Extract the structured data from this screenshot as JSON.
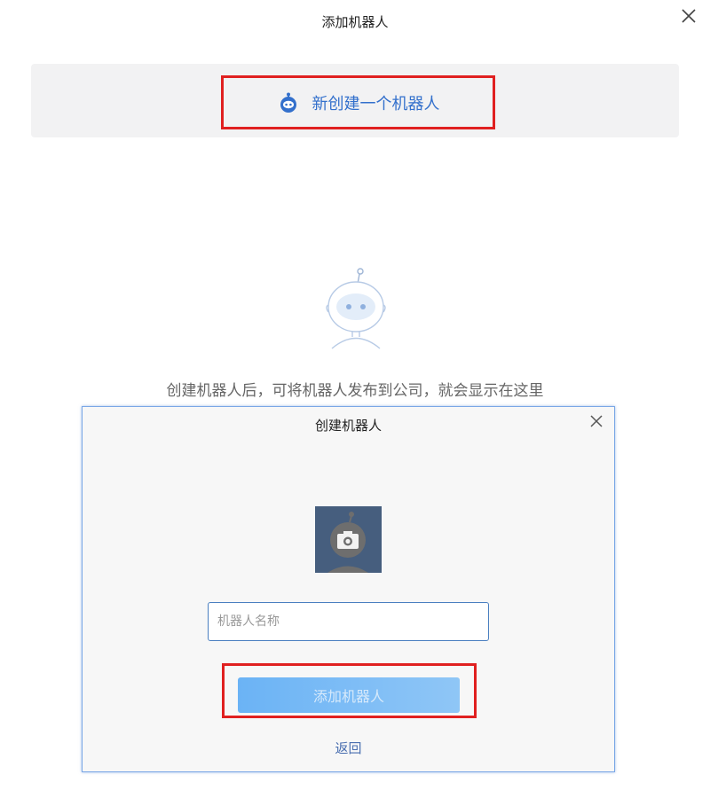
{
  "header": {
    "title": "添加机器人"
  },
  "new_robot": {
    "label": "新创建一个机器人"
  },
  "empty_state": {
    "hint": "创建机器人后，可将机器人发布到公司，就会显示在这里"
  },
  "dialog": {
    "title": "创建机器人",
    "name_input": {
      "placeholder": "机器人名称",
      "value": ""
    },
    "submit_label": "添加机器人",
    "back_label": "返回"
  },
  "icons": {
    "close": "close-icon",
    "robot": "robot-icon",
    "camera": "camera-icon"
  },
  "colors": {
    "accent": "#3370cc",
    "highlight": "#e02020",
    "button": "#6bb3f5"
  }
}
